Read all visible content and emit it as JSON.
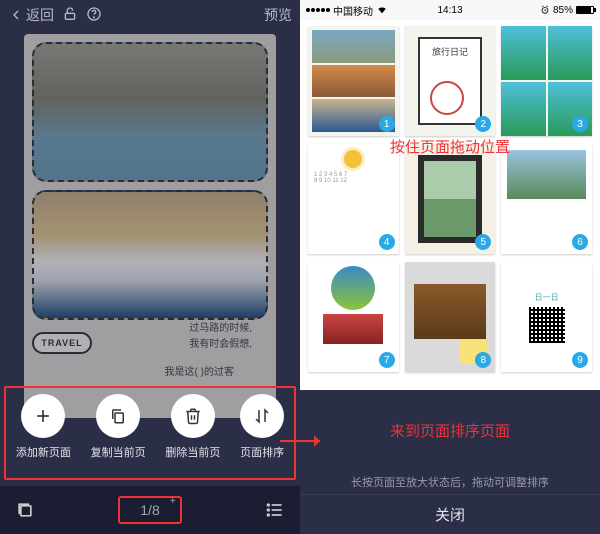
{
  "left": {
    "topbar": {
      "back": "返回",
      "preview": "预览"
    },
    "canvas": {
      "travel_badge": "TRAVEL",
      "line1": "过马路的时候,",
      "line2": "我有时会假想,",
      "line3": "我是这(        )的过客"
    },
    "actions": [
      {
        "label": "添加新页面"
      },
      {
        "label": "复制当前页"
      },
      {
        "label": "删除当前页"
      },
      {
        "label": "页面排序"
      }
    ],
    "bottombar": {
      "page_indicator": "1/8"
    }
  },
  "right": {
    "statusbar": {
      "carrier": "中国移动",
      "time": "14:13",
      "battery": "85%"
    },
    "thumb2_title": "旅行日记",
    "thumb9_text": "日一日",
    "annot_drag": "按住页面拖动位置",
    "annot_arrive": "来到页面排序页面",
    "hint": "长按页面至放大状态后，拖动可调整排序",
    "close": "关闭"
  }
}
